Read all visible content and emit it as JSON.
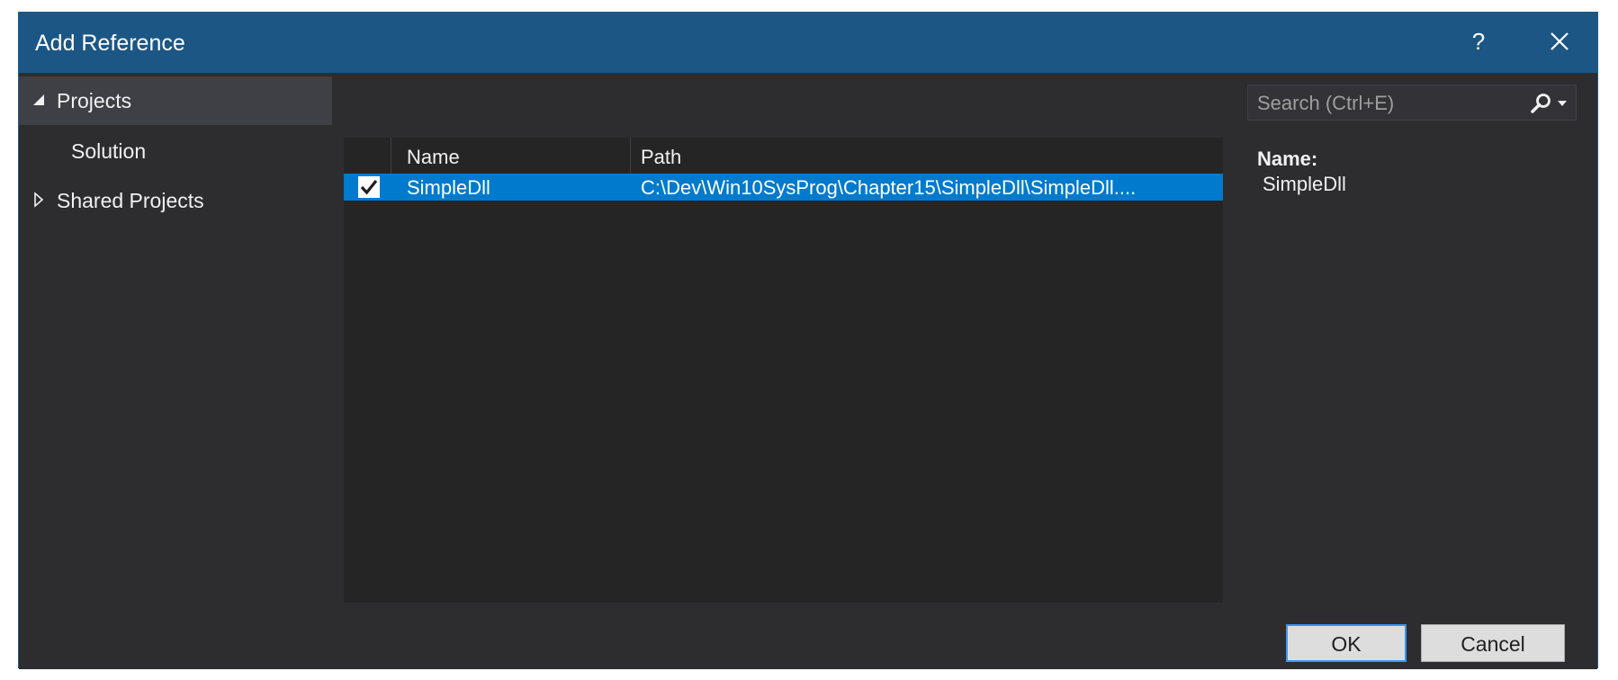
{
  "window": {
    "title": "Add Reference",
    "help_label": "?"
  },
  "nav": {
    "items": [
      {
        "label": "Projects",
        "expanded": true,
        "selected": true
      },
      {
        "label": "Solution"
      },
      {
        "label": "Shared Projects",
        "expanded": false
      }
    ]
  },
  "search": {
    "placeholder": "Search (Ctrl+E)"
  },
  "list": {
    "columns": [
      "Name",
      "Path"
    ],
    "rows": [
      {
        "checked": true,
        "name": "SimpleDll",
        "path": "C:\\Dev\\Win10SysProg\\Chapter15\\SimpleDll\\SimpleDll...."
      }
    ]
  },
  "details": {
    "name_label": "Name:",
    "name_value": "SimpleDll"
  },
  "buttons": {
    "ok": "OK",
    "cancel": "Cancel"
  },
  "colors": {
    "titlebar": "#1c5684",
    "background": "#2d2d30",
    "selection": "#007acc",
    "list_bg": "#252526"
  }
}
